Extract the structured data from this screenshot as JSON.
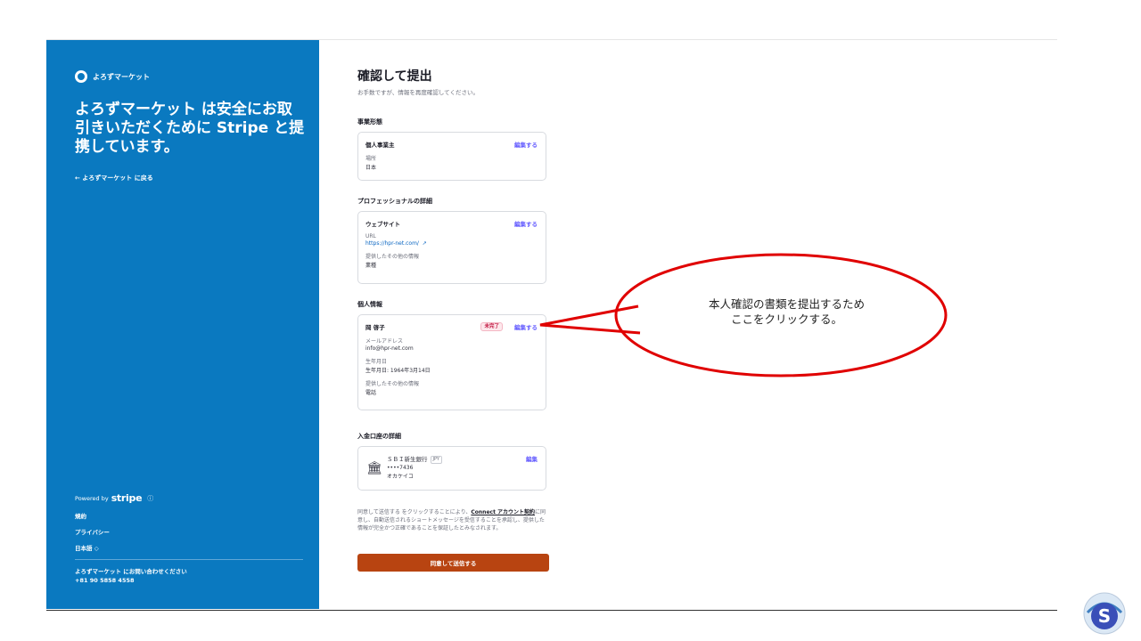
{
  "sidebar": {
    "brand_name": "よろずマーケット",
    "headline": "よろずマーケット は安全にお取引きいただくために Stripe と提携しています。",
    "back_link": "← よろずマーケット に戻る",
    "powered_by": "Powered by",
    "stripe_word": "stripe",
    "info_icon": "info-icon",
    "terms": "規約",
    "privacy": "プライバシー",
    "language": "日本語 ◇",
    "contact_label": "よろずマーケット にお問い合わせください",
    "contact_phone": "+81 90 5858 4558"
  },
  "main": {
    "title": "確認して提出",
    "subtitle": "お手数ですが、情報を再度確認してください。",
    "business_type": {
      "section": "事業形態",
      "card_title": "個人事業主",
      "edit": "編集する",
      "label": "場所",
      "value": "日本"
    },
    "professional": {
      "section": "プロフェッショナルの詳細",
      "card_title": "ウェブサイト",
      "edit": "編集する",
      "url_label": "URL",
      "url_value": "https://hpr-net.com/",
      "extra_label": "提供したその他の情報",
      "extra_value": "業種"
    },
    "personal": {
      "section": "個人情報",
      "name": "岡 啓子",
      "badge": "未完了",
      "edit": "編集する",
      "email_label": "メールアドレス",
      "email_value": "info@hpr-net.com",
      "dob_label": "生年月日",
      "dob_value": "生年月日: 1964年3月14日",
      "extra_label": "提供したその他の情報",
      "extra_value": "電話"
    },
    "bank": {
      "section": "入金口座の詳細",
      "bank_name": "ＳＢＩ新生銀行",
      "currency": "JPY",
      "account": "••••7436",
      "holder": "オカケイコ",
      "edit": "編集"
    },
    "consent_prefix": "同意して送信する をクリックすることにより、",
    "consent_link": "Connect アカウント契約",
    "consent_suffix": "に同意し、自動送信されるショートメッセージを受信することを承認し、提供した情報が完全かつ正確であることを保証したとみなされます。",
    "submit": "同意して送信する"
  },
  "annotation": {
    "line1": "本人確認の書類を提出するため",
    "line2": "ここをクリックする。",
    "stroke_color": "#e00000"
  },
  "colors": {
    "sidebar_bg": "#0a79c0",
    "submit_bg": "#b84411",
    "link": "#635bff"
  }
}
